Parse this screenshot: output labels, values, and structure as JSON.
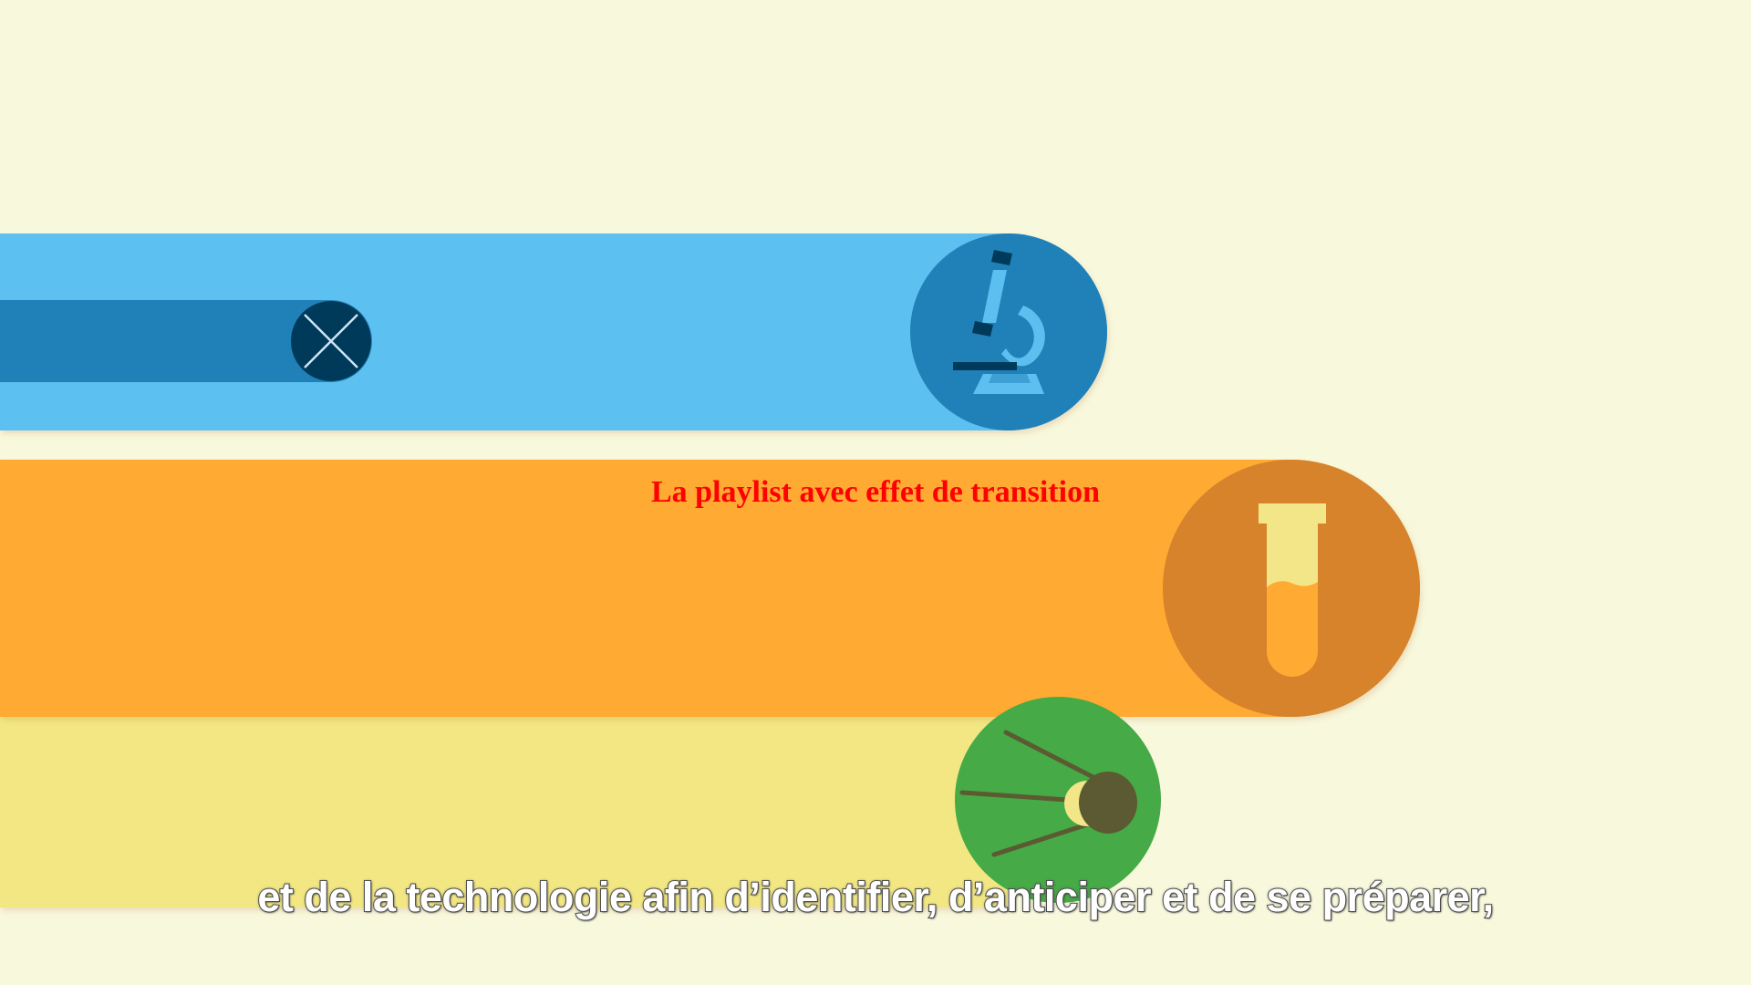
{
  "overlay": {
    "title": "La playlist avec effet de transition",
    "title_color": "#ff0000"
  },
  "subtitle": {
    "text": "et de la technologie afin d’identifier, d’anticiper et de se préparer,"
  },
  "colors": {
    "background": "#f8f8dc",
    "blue_band": "#5bc0f0",
    "blue_dark": "#2080b8",
    "navy": "#003a5a",
    "orange_band": "#ffaa33",
    "orange_dark": "#d6832b",
    "yellow_band": "#f2e783",
    "pale_yellow": "#f3e688",
    "green": "#46aa46",
    "olive": "#5b5a33"
  },
  "icons": {
    "band1": "microscope-icon",
    "band2": "test-tube-icon",
    "band3": "satellite-icon",
    "inner_bar": "close-circle-icon"
  }
}
